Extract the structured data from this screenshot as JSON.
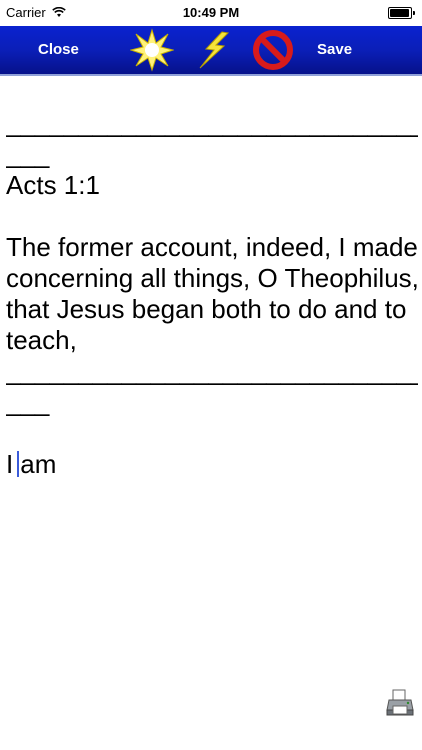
{
  "status": {
    "carrier": "Carrier",
    "time": "10:49 PM"
  },
  "toolbar": {
    "close_label": "Close",
    "save_label": "Save",
    "icons": [
      "burst-icon",
      "lightning-icon",
      "prohibited-icon"
    ]
  },
  "editor": {
    "separator_top_1": "______________________________",
    "separator_top_2": "___",
    "reference": "Acts 1:1",
    "verse_lines": [
      "The former account, indeed, I made",
      "concerning all things, O Theophilus,",
      "that Jesus began both to do and to",
      "teach,"
    ],
    "separator_bottom_1": "______________________________",
    "separator_bottom_2": "___",
    "typed_before_cursor": "I",
    "typed_after_cursor": "am"
  },
  "colors": {
    "toolbar": "#0b1fb8",
    "cursor": "#3a5bd9"
  }
}
